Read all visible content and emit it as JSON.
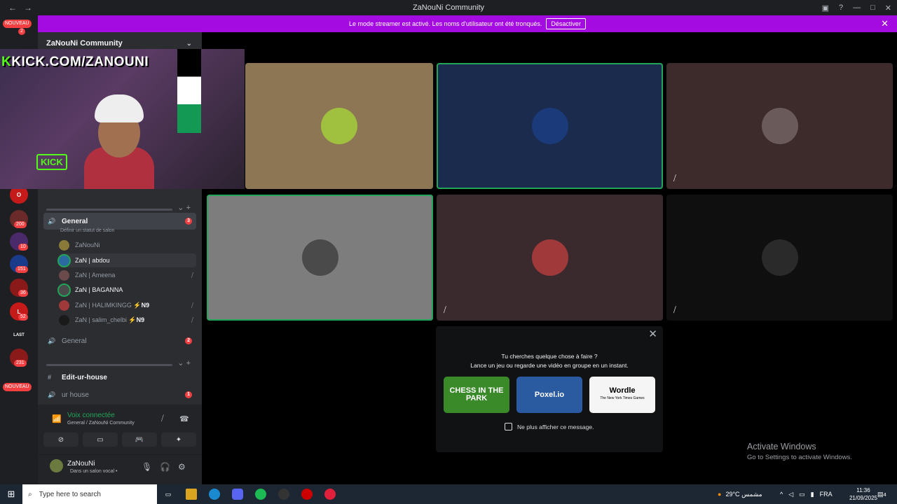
{
  "window": {
    "title": "ZaNouNi Community",
    "back": "←",
    "forward": "→"
  },
  "banner": {
    "text": "Le mode streamer est activé. Les noms d'utilisateur ont été tronqués.",
    "button": "Désactiver",
    "close": "✕"
  },
  "guilds": {
    "badge_nouveau": "NOUVEAU",
    "items": [
      {
        "badge": "2"
      },
      {
        "badge": ""
      },
      {
        "badge": "200"
      },
      {
        "badge": "10"
      },
      {
        "badge": "151"
      },
      {
        "badge": "36"
      },
      {
        "badge": "52"
      },
      {
        "badge": "231"
      }
    ],
    "last_label": "LAST"
  },
  "server": {
    "name": "ZaNouNi Community"
  },
  "webcam": {
    "overlay": "KICK.COM/ZANOUNI",
    "k": "K",
    "sign": "KICK"
  },
  "channels": {
    "general_active": {
      "name": "General",
      "count": "3",
      "status": "Définir un statut de salon"
    },
    "voice_users": [
      {
        "name": "ZaNouNi",
        "tag": "",
        "muted": false
      },
      {
        "name": "ZaN | abdou",
        "tag": "",
        "muted": false
      },
      {
        "name": "ZaN | Ameena",
        "tag": "",
        "muted": true
      },
      {
        "name": "ZaN | BAGANNA",
        "tag": "",
        "muted": false
      },
      {
        "name": "ZaN | HALIMKINGG",
        "tag": "⚡N9",
        "muted": true
      },
      {
        "name": "ZaN | salim_chelbi",
        "tag": "⚡N9",
        "muted": true
      }
    ],
    "general2": {
      "name": "General",
      "count": "2"
    },
    "edit": {
      "name": "Edit-ur-house"
    },
    "urhouse": {
      "name": "ur house",
      "count": "1"
    }
  },
  "voice": {
    "connected": "Voix connectée",
    "location": "General / ZaNouNi Community"
  },
  "user": {
    "name": "ZaNouNi",
    "status": "Dans un salon vocal •"
  },
  "suggest": {
    "line1": "Tu cherches quelque chose à faire ?",
    "line2": "Lance un jeu ou regarde une vidéo en groupe en un instant.",
    "games": [
      "CHESS IN THE PARK",
      "Poxel.io",
      "Wordle"
    ],
    "wordle_sub": "The New York Times Games",
    "checkbox": "Ne plus afficher ce message."
  },
  "watermark": {
    "line1": "Activate Windows",
    "line2": "Go to Settings to activate Windows."
  },
  "taskbar": {
    "search_placeholder": "Type here to search",
    "weather": "29°C",
    "weather_desc": "مشمس",
    "lang": "FRA",
    "time": "11:36",
    "date": "21/09/2025",
    "notif": "4"
  },
  "colors": {
    "accent": "#a40be0",
    "speaking": "#23a559",
    "badge": "#f23f42"
  }
}
